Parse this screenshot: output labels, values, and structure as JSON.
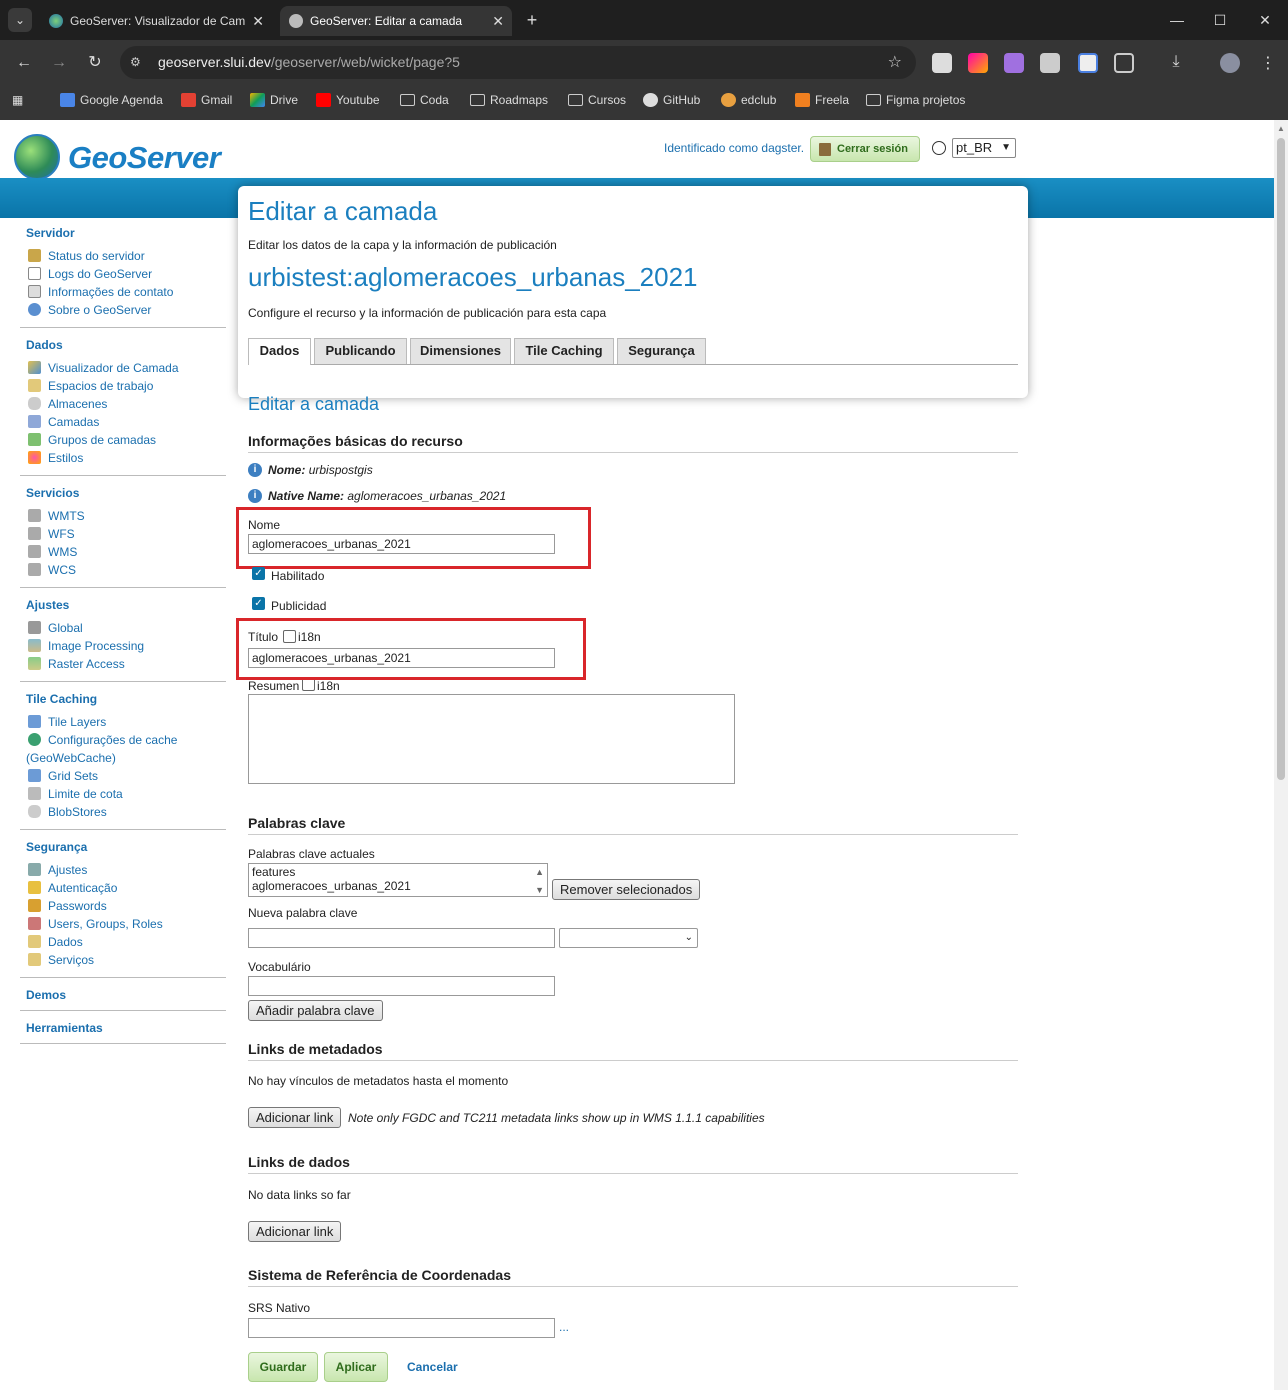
{
  "browser": {
    "tabs": [
      {
        "title": "GeoServer: Visualizador de Cam",
        "active": false
      },
      {
        "title": "GeoServer: Editar a camada",
        "active": true
      }
    ],
    "url_host": "geoserver.slui.dev",
    "url_path": "/geoserver/web/wicket/page?5",
    "bookmarks": [
      "Google Agenda",
      "Gmail",
      "Drive",
      "Youtube",
      "Coda",
      "Roadmaps",
      "Cursos",
      "GitHub",
      "edclub",
      "Freela",
      "Figma projetos"
    ]
  },
  "header": {
    "brand": "GeoServer",
    "login_text": "Identificado como dagster.",
    "logout_label": "Cerrar sesión",
    "language": "pt_BR"
  },
  "sidebar": {
    "sections": [
      {
        "title": "Servidor",
        "items": [
          "Status do servidor",
          "Logs do GeoServer",
          "Informações de contato",
          "Sobre o GeoServer"
        ]
      },
      {
        "title": "Dados",
        "items": [
          "Visualizador de Camada",
          "Espacios de trabajo",
          "Almacenes",
          "Camadas",
          "Grupos de camadas",
          "Estilos"
        ]
      },
      {
        "title": "Servicios",
        "items": [
          "WMTS",
          "WFS",
          "WMS",
          "WCS"
        ]
      },
      {
        "title": "Ajustes",
        "items": [
          "Global",
          "Image Processing",
          "Raster Access"
        ]
      },
      {
        "title": "Tile Caching",
        "items": [
          "Tile Layers",
          "Configurações de cache (GeoWebCache)",
          "Grid Sets",
          "Limite de cota",
          "BlobStores"
        ]
      },
      {
        "title": "Segurança",
        "items": [
          "Ajustes",
          "Autenticação",
          "Passwords",
          "Users, Groups, Roles",
          "Dados",
          "Serviços"
        ]
      },
      {
        "title": "Demos",
        "items": []
      },
      {
        "title": "Herramientas",
        "items": []
      }
    ]
  },
  "main": {
    "title": "Editar a camada",
    "subtitle": "Editar los datos de la capa y la información de publicación",
    "layer_name": "urbistest:aglomeracoes_urbanas_2021",
    "layer_subtitle": "Configure el recurso y la información de publicación para esta capa",
    "tabs": [
      "Dados",
      "Publicando",
      "Dimensiones",
      "Tile Caching",
      "Segurança"
    ],
    "section_title": "Editar a camada",
    "basic_info_title": "Informações básicas do recurso",
    "name_label": "Nome:",
    "name_value": "urbispostgis",
    "native_label": "Native Name:",
    "native_value": "aglomeracoes_urbanas_2021",
    "nome_label": "Nome",
    "nome_value": "aglomeracoes_urbanas_2021",
    "enabled_label": "Habilitado",
    "enabled": true,
    "advertised_label": "Publicidad",
    "advertised": true,
    "title_label": "Título",
    "i18n_label": "i18n",
    "title_value": "aglomeracoes_urbanas_2021",
    "abstract_label": "Resumen",
    "keywords_title": "Palabras clave",
    "current_keywords_label": "Palabras clave actuales",
    "keywords": [
      "features",
      "aglomeracoes_urbanas_2021"
    ],
    "remove_selected": "Remover selecionados",
    "new_keyword_label": "Nueva palabra clave",
    "vocabulary_label": "Vocabulário",
    "add_keyword": "Añadir palabra clave",
    "metadata_links_title": "Links de metadados",
    "no_metadata_links": "No hay vínculos de metadatos hasta el momento",
    "add_link": "Adicionar link",
    "metadata_note": "Note only FGDC and TC211 metadata links show up in WMS 1.1.1 capabilities",
    "data_links_title": "Links de dados",
    "no_data_links": "No data links so far",
    "crs_title": "Sistema de Referência de Coordenadas",
    "native_srs_label": "SRS Nativo",
    "srs_more": "...",
    "save": "Guardar",
    "apply": "Aplicar",
    "cancel": "Cancelar"
  },
  "colors": {
    "accent": "#1b7fbf",
    "band": "#0a74a8",
    "highlight": "#d9262a"
  }
}
